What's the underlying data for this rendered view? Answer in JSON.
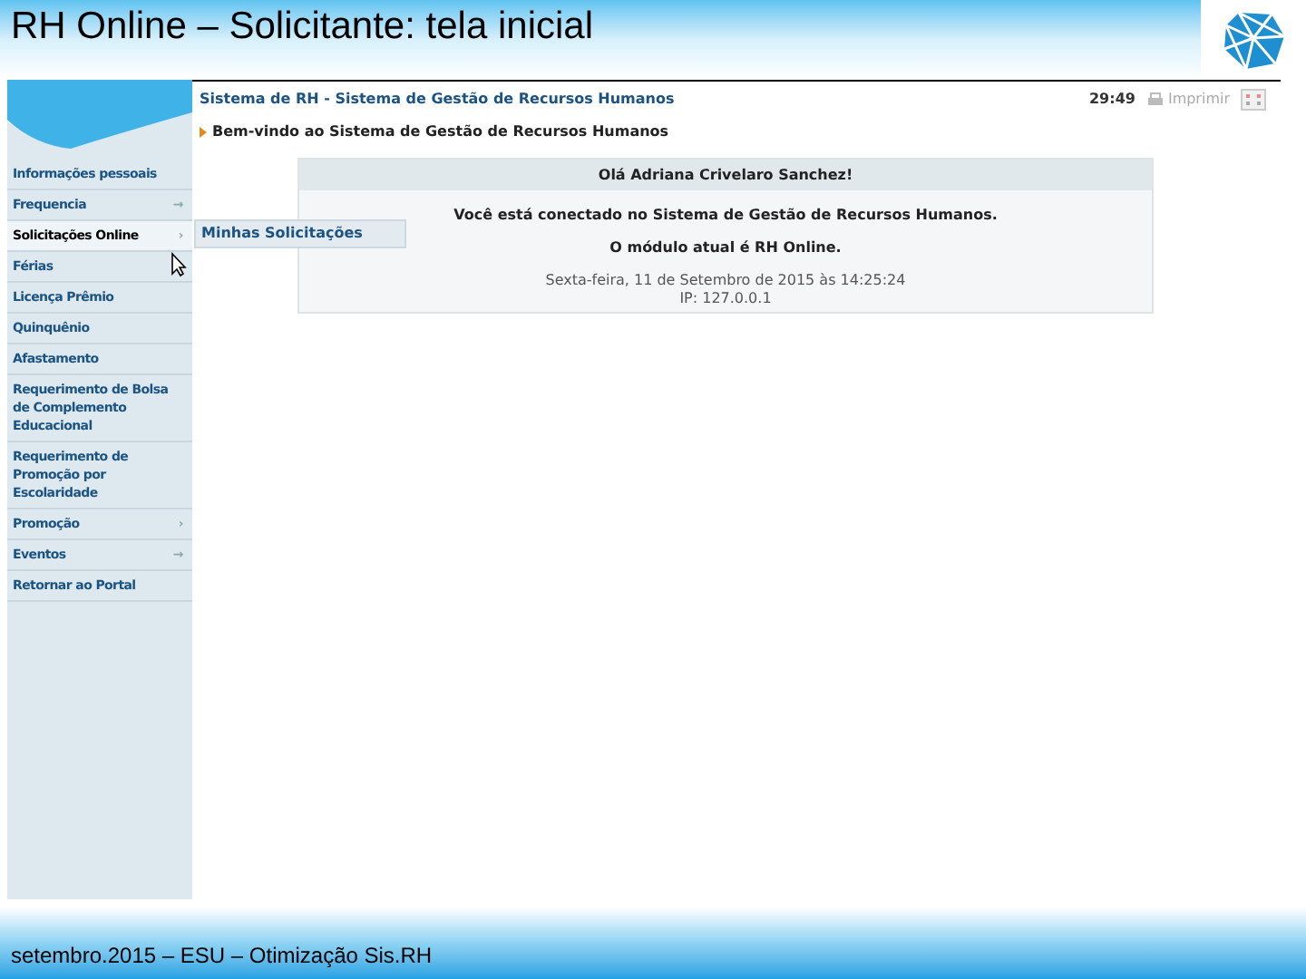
{
  "slide": {
    "title": "RH Online – Solicitante: tela inicial",
    "footer": "setembro.2015 – ESU – Otimização Sis.RH"
  },
  "app": {
    "header_title": "Sistema de RH - Sistema de Gestão de Recursos Humanos",
    "welcome": "Bem-vindo ao Sistema de Gestão de Recursos Humanos",
    "time": "29:49",
    "print": "Imprimir",
    "sidebar": {
      "items": [
        {
          "label": "Informações pessoais",
          "selected": false
        },
        {
          "label": "Frequencia",
          "arrow": "→",
          "selected": false
        },
        {
          "label": "Solicitações Online",
          "arrow": "›",
          "selected": true
        },
        {
          "label": "Férias",
          "selected": false
        },
        {
          "label": "Licença Prêmio",
          "selected": false
        },
        {
          "label": "Quinquênio",
          "selected": false
        },
        {
          "label": "Afastamento",
          "selected": false
        },
        {
          "label": "Requerimento de Bolsa de Complemento Educacional",
          "selected": false
        },
        {
          "label": "Requerimento de Promoção por Escolaridade",
          "selected": false
        },
        {
          "label": "Promoção",
          "arrow": "›",
          "selected": false
        },
        {
          "label": "Eventos",
          "arrow": "→",
          "selected": false
        },
        {
          "label": "Retornar ao Portal",
          "selected": false
        }
      ]
    },
    "submenu": {
      "items": [
        "Minhas Solicitações"
      ]
    },
    "panel": {
      "greeting": "Olá Adriana Crivelaro Sanchez!",
      "lines": [
        {
          "text": "Você está conectado no Sistema de Gestão de Recursos Humanos.",
          "kind": "bold"
        },
        {
          "text": "O módulo atual é RH Online.",
          "kind": "bold"
        },
        {
          "text": "Sexta-feira, 11 de Setembro de 2015 às 14:25:24",
          "kind": "plain"
        },
        {
          "text": "IP: 127.0.0.1",
          "kind": "plain"
        }
      ]
    }
  }
}
